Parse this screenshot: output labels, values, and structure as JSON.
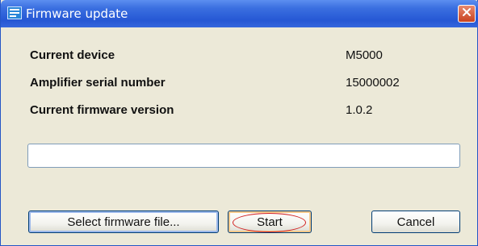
{
  "window": {
    "title": "Firmware update",
    "icon": "firmware-window-icon",
    "close_icon": "close-icon",
    "colors": {
      "titlebar": "#2657d4",
      "close_button": "#c8421f",
      "face": "#ece9d8"
    }
  },
  "info": [
    {
      "label": "Current device",
      "value": "M5000"
    },
    {
      "label": "Amplifier serial number",
      "value": "15000002"
    },
    {
      "label": "Current firmware version",
      "value": "1.0.2"
    }
  ],
  "progress": {
    "value": 0
  },
  "buttons": {
    "select_label": "Select firmware file...",
    "start_label": "Start",
    "cancel_label": "Cancel"
  },
  "annotation": {
    "highlighted": "start-button",
    "color": "#d21e1e"
  }
}
